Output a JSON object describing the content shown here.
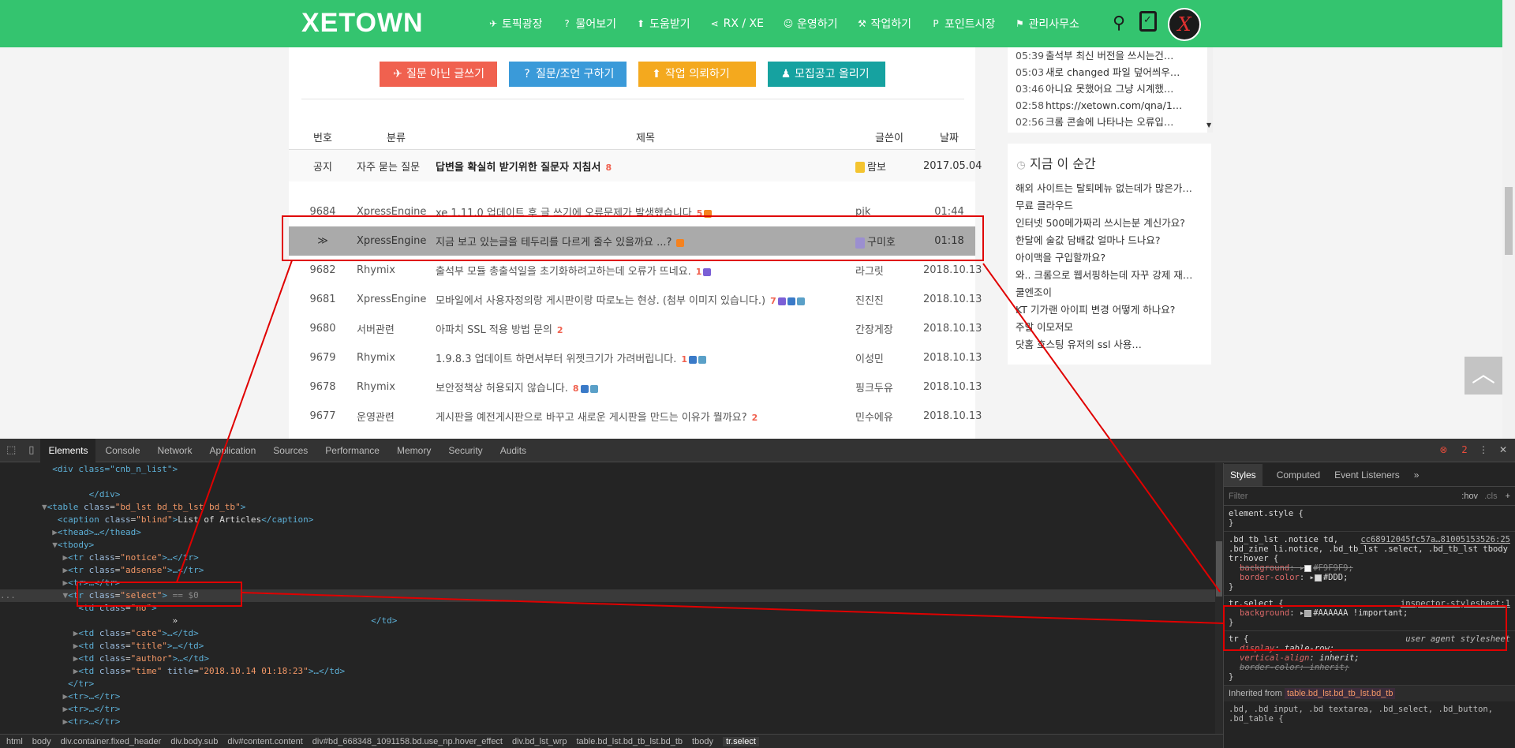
{
  "header": {
    "logo": "XETOWN",
    "nav": [
      {
        "icon": "✈",
        "label": "토픽광장"
      },
      {
        "icon": "?",
        "label": "물어보기"
      },
      {
        "icon": "⬆",
        "label": "도움받기"
      },
      {
        "icon": "⋖",
        "label": "RX / XE"
      },
      {
        "icon": "☺",
        "label": "운영하기"
      },
      {
        "icon": "⚒",
        "label": "작업하기"
      },
      {
        "icon": "P",
        "label": "포인트시장"
      },
      {
        "icon": "⚑",
        "label": "관리사무소"
      }
    ],
    "avatar_letter": "X"
  },
  "buttons": {
    "write": {
      "icon": "✈",
      "label": "질문 아닌 글쓰기"
    },
    "ask": {
      "icon": "?",
      "label": "질문/조언 구하기"
    },
    "request": {
      "icon": "⬆",
      "label": "작업 의뢰하기"
    },
    "job": {
      "icon": "♟",
      "label": "모집공고 올리기"
    }
  },
  "table": {
    "headers": {
      "no": "번호",
      "cate": "분류",
      "title": "제목",
      "author": "글쓴이",
      "time": "날짜"
    },
    "notice": {
      "no": "공지",
      "cate": "자주 묻는 질문",
      "title": "답변을 확실히 받기위한 질문자 지침서",
      "comments": "8",
      "author": "람보",
      "time": "2017.05.04"
    },
    "rows": [
      {
        "no": "9684",
        "cate": "XpressEngine",
        "title": "xe 1.11.0 업데이트 후 글 쓰기에 오류문제가 발생했습니다",
        "comments": "5",
        "author": "pjk",
        "time": "01:44"
      },
      {
        "no": "≫",
        "cate": "XpressEngine",
        "title": "지금 보고 있는글을 테두리를 다르게 줄수 있을까요 ...?",
        "comments": "",
        "author": "구미호",
        "time": "01:18"
      },
      {
        "no": "9682",
        "cate": "Rhymix",
        "title": "출석부 모듈 총출석일을 초기화하려고하는데 오류가 뜨네요.",
        "comments": "1",
        "author": "라그릿",
        "time": "2018.10.13"
      },
      {
        "no": "9681",
        "cate": "XpressEngine",
        "title": "모바일에서 사용자정의랑 게시판이랑 따로노는 현상. (첨부 이미지 있습니다.)",
        "comments": "7",
        "author": "진진진",
        "time": "2018.10.13"
      },
      {
        "no": "9680",
        "cate": "서버관련",
        "title": "아파치 SSL 적용 방법 문의",
        "comments": "2",
        "author": "간장게장",
        "time": "2018.10.13"
      },
      {
        "no": "9679",
        "cate": "Rhymix",
        "title": "1.9.8.3 업데이트 하면서부터 위젯크기가 가려버립니다.",
        "comments": "1",
        "author": "이성민",
        "time": "2018.10.13"
      },
      {
        "no": "9678",
        "cate": "Rhymix",
        "title": "보안정책상 허용되지 않습니다.",
        "comments": "8",
        "author": "핑크두유",
        "time": "2018.10.13"
      },
      {
        "no": "9677",
        "cate": "운영관련",
        "title": "게시판을 예전게시판으로 바꾸고 새로운 게시판을 만드는 이유가 뭘까요?",
        "comments": "2",
        "author": "민수에유",
        "time": "2018.10.13"
      }
    ]
  },
  "side_recent": [
    {
      "time": "05:39",
      "text": "출석부 최신 버전을 쓰시는건…"
    },
    {
      "time": "05:03",
      "text": "새로 changed 파일 덮어씌우…"
    },
    {
      "time": "03:46",
      "text": "아니요 못했어요 그냥 시계했…"
    },
    {
      "time": "02:58",
      "text": "https://xetown.com/qna/1…"
    },
    {
      "time": "02:56",
      "text": "크롬 콘솔에 나타나는 오류입…"
    }
  ],
  "side_now": {
    "title": "지금 이 순간",
    "items": [
      "해외 사이트는 탈퇴메뉴 없는데가 많은가…",
      "무료 클라우드",
      "인터넷 500메가짜리 쓰시는분 계신가요?",
      "한달에 술값 담배값 얼마나 드나요?",
      "아이맥을 구입할까요?",
      "와.. 크롬으로 웹서핑하는데 자꾸 강제 재…",
      "쿨엔조이",
      "KT 기가랜 아이피 변경 어떻게 하나요?",
      "주말 이모저모",
      "닷홈 호스팅 유저의 ssl 사용…"
    ]
  },
  "devtools": {
    "tabs": [
      "Elements",
      "Console",
      "Network",
      "Application",
      "Sources",
      "Performance",
      "Memory",
      "Security",
      "Audits"
    ],
    "error_count": "2",
    "elements": {
      "l1": "<div class=\"cnb_n_list\">",
      "l2": "</div>",
      "l3_tag": "table",
      "l3_class": "bd_lst bd_tb_lst bd_tb",
      "l4_class": "blind",
      "l4_text": "List of Articles",
      "l5": "<thead>…</thead>",
      "l6": "<tbody>",
      "l7_class": "notice",
      "l8_class": "adsense",
      "l9": "<tr>…</tr>",
      "l10_class": "select",
      "l10_suffix": " == $0",
      "l11_class": "no",
      "l12": "»",
      "l12_end": "</td>",
      "l13_class": "cate",
      "l14_class": "title",
      "l15_class": "author",
      "l16_class": "time",
      "l16_title": "2018.10.14 01:18:23",
      "l17": "</tr>",
      "l18": "<tr>…</tr>",
      "l19": "<tr>…</tr>",
      "l20": "<tr>…</tr>"
    },
    "breadcrumb": [
      "html",
      "body",
      "div.container.fixed_header",
      "div.body.sub",
      "div#content.content",
      "div#bd_668348_1091158.bd.use_np.hover_effect",
      "div.bd_lst_wrp",
      "table.bd_lst.bd_tb_lst.bd_tb",
      "tbody",
      "tr.select"
    ],
    "styles": {
      "tabs": [
        "Styles",
        "Computed",
        "Event Listeners",
        "»"
      ],
      "filter_placeholder": "Filter",
      "hov": ":hov",
      "cls": ".cls",
      "element_style": "element.style {",
      "rule1_selector": ".bd_tb_lst .notice td, .bd_zine li.notice, .bd_tb_lst .select, .bd_tb_lst tbody tr:hover {",
      "rule1_src": "cc68912045fc57a…81005153526:25",
      "rule1_p1": "background",
      "rule1_v1": "#F9F9F9;",
      "rule1_p2": "border-color",
      "rule1_v2": "#DDD;",
      "rule2_selector": "tr.select {",
      "rule2_src": "inspector-stylesheet:1",
      "rule2_p1": "background",
      "rule2_v1": "#AAAAAA !important;",
      "rule3_selector": "tr {",
      "rule3_src": "user agent stylesheet",
      "rule3_p1": "display",
      "rule3_v1": "table-row;",
      "rule3_p2": "vertical-align",
      "rule3_v2": "inherit;",
      "rule3_p3": "border-color",
      "rule3_v3": "inherit;",
      "inherited_label": "Inherited from",
      "inherited_from": "table.bd_lst.bd_tb_lst.bd_tb",
      "tail": ".bd, .bd input, .bd textarea, .bd_select, .bd_button, .bd_table {"
    }
  },
  "colors": {
    "header_green": "#34c46f",
    "select_bg": "#AAAAAA",
    "annotation_red": "#e00000"
  }
}
